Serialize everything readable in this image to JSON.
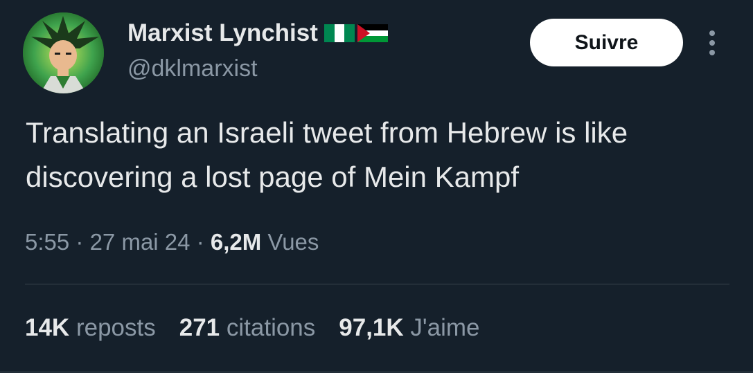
{
  "author": {
    "name": "Marxist Lynchist",
    "handle": "@dklmarxist",
    "avatar_icon": "anime-character-avatar",
    "flags": [
      "nigeria-flag-icon",
      "palestine-flag-icon"
    ]
  },
  "actions": {
    "follow_label": "Suivre",
    "more_icon": "more-vertical-icon"
  },
  "tweet": {
    "text": "Translating an Israeli tweet from Hebrew is like discovering a lost page of Mein Kampf"
  },
  "meta": {
    "time": "5:55",
    "separator": "·",
    "date": "27 mai 24",
    "views_count": "6,2M",
    "views_label": "Vues"
  },
  "stats": {
    "reposts_count": "14K",
    "reposts_label": "reposts",
    "quotes_count": "271",
    "quotes_label": "citations",
    "likes_count": "97,1K",
    "likes_label": "J'aime"
  },
  "colors": {
    "background": "#15202b",
    "primary_text": "#e7e9ea",
    "secondary_text": "#8b98a5",
    "divider": "#38444d"
  }
}
